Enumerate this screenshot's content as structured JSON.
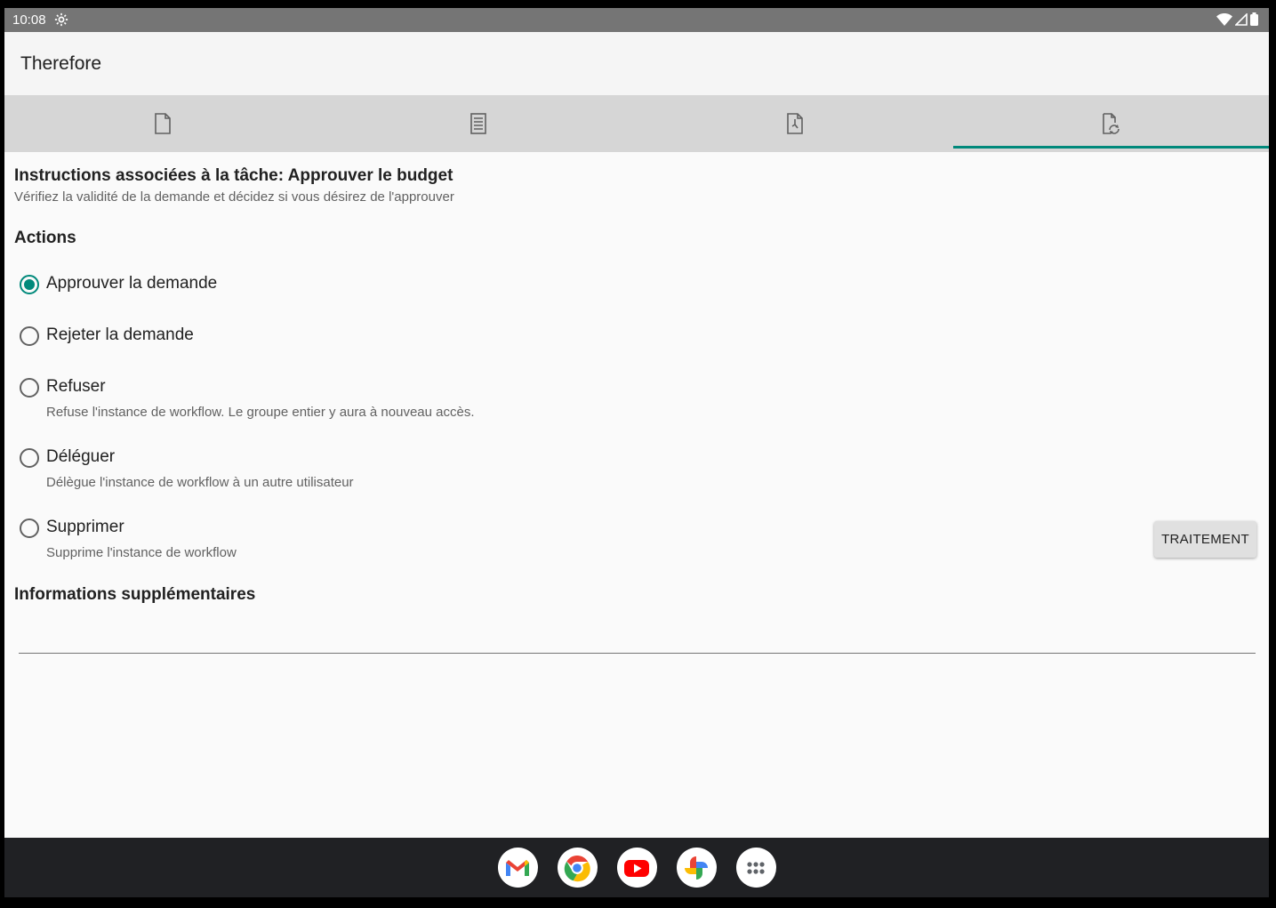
{
  "status_bar": {
    "time": "10:08"
  },
  "app": {
    "title": "Therefore"
  },
  "tabs": [
    {
      "icon": "document-icon",
      "active": false
    },
    {
      "icon": "index-list-icon",
      "active": false
    },
    {
      "icon": "history-icon",
      "active": false
    },
    {
      "icon": "workflow-icon",
      "active": true
    }
  ],
  "task": {
    "instructions_title": "Instructions associées à la tâche: Approuver le budget",
    "instructions_desc": "Vérifiez la validité de la demande et décidez si vous désirez de l'approuver"
  },
  "actions": {
    "title": "Actions",
    "options": [
      {
        "label": "Approuver la demande",
        "description": "",
        "checked": true
      },
      {
        "label": "Rejeter la demande",
        "description": "",
        "checked": false
      },
      {
        "label": "Refuser",
        "description": "Refuse l'instance de workflow. Le groupe entier y aura à nouveau accès.",
        "checked": false
      },
      {
        "label": "Déléguer",
        "description": "Délègue l'instance de workflow à un autre utilisateur",
        "checked": false
      },
      {
        "label": "Supprimer",
        "description": "Supprime l'instance de workflow",
        "checked": false
      }
    ],
    "process_button": "TRAITEMENT"
  },
  "additional": {
    "title": "Informations supplémentaires",
    "value": ""
  },
  "dock": {
    "apps": [
      "gmail-icon",
      "chrome-icon",
      "youtube-icon",
      "photos-icon",
      "app-drawer-icon"
    ]
  },
  "colors": {
    "accent": "#00897b",
    "status_bar": "#757575",
    "tab_bar": "#d6d6d6",
    "dock": "#202124"
  }
}
